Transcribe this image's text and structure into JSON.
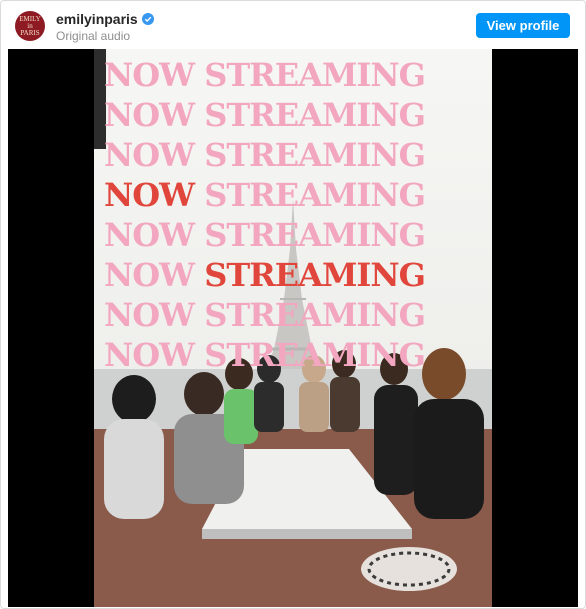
{
  "header": {
    "avatar_text": [
      "EMILY",
      "in",
      "PARIS"
    ],
    "username": "emilyinparis",
    "audio_label": "Original audio",
    "view_profile_label": "View profile"
  },
  "post": {
    "lines": [
      {
        "left": "NOW",
        "right": "STREAMING",
        "left_color": "pink",
        "right_color": "pink"
      },
      {
        "left": "NOW",
        "right": "STREAMING",
        "left_color": "pink",
        "right_color": "pink"
      },
      {
        "left": "NOW",
        "right": "STREAMING",
        "left_color": "pink",
        "right_color": "pink"
      },
      {
        "left": "NOW",
        "right": "STREAMING",
        "left_color": "red",
        "right_color": "pink"
      },
      {
        "left": "NOW",
        "right": "STREAMING",
        "left_color": "pink",
        "right_color": "pink"
      },
      {
        "left": "NOW",
        "right": "STREAMING",
        "left_color": "pink",
        "right_color": "red"
      },
      {
        "left": "NOW",
        "right": "STREAMING",
        "left_color": "pink",
        "right_color": "pink"
      },
      {
        "left": "NOW",
        "right": "STREAMING",
        "left_color": "pink",
        "right_color": "pink"
      }
    ]
  },
  "colors": {
    "pink": "#f3a6c0",
    "red": "#e0463b",
    "button": "#0095f6",
    "verified": "#3897f0"
  }
}
